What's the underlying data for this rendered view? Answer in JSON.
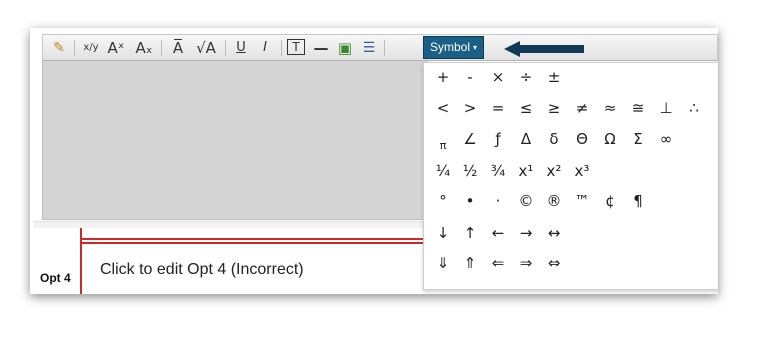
{
  "toolbar": {
    "items": [
      {
        "name": "image-edit-icon",
        "glyph": "✎"
      },
      {
        "name": "fraction-icon",
        "glyph": "x/y"
      },
      {
        "name": "superscript-icon",
        "glyph": "Aˣ"
      },
      {
        "name": "subscript-icon",
        "glyph": "Aₓ"
      },
      {
        "name": "overline-icon",
        "glyph": "A̅"
      },
      {
        "name": "square-root-icon",
        "glyph": "√A"
      },
      {
        "name": "underline-icon",
        "glyph": "U"
      },
      {
        "name": "italic-icon",
        "glyph": "I"
      },
      {
        "name": "text-box-icon",
        "glyph": "T"
      },
      {
        "name": "horizontal-rule-icon",
        "glyph": "—"
      },
      {
        "name": "insert-image-icon",
        "glyph": "▣"
      },
      {
        "name": "bullet-list-icon",
        "glyph": "☰"
      }
    ],
    "symbol_button": {
      "label": "Symbol",
      "caret": "▾"
    }
  },
  "option": {
    "label": "Opt 4",
    "text": "Click to edit Opt 4 (Incorrect)"
  },
  "symbol_menu": {
    "rows": [
      [
        "+",
        "-",
        "×",
        "÷",
        "±"
      ],
      [
        "<",
        ">",
        "=",
        "≤",
        "≥",
        "≠",
        "≈",
        "≅",
        "⊥",
        "∴"
      ],
      [
        "π",
        "∠",
        "ƒ",
        "Δ",
        "δ",
        "Θ",
        "Ω",
        "Σ",
        "∞"
      ],
      [
        "¼",
        "½",
        "¾",
        "x¹",
        "x²",
        "x³"
      ],
      [
        "°",
        "•",
        "·",
        "©",
        "®",
        "™",
        "¢",
        "¶"
      ],
      [
        "↓",
        "↑",
        "←",
        "→",
        "↔"
      ],
      [
        "⇓",
        "⇑",
        "⇐",
        "⇒",
        "⇔"
      ]
    ]
  },
  "colors": {
    "symbol_button_bg": "#1a5f85",
    "callout_arrow": "#123a55",
    "editor_bg": "#d4d4d4",
    "option_border": "#cf2a2a"
  }
}
